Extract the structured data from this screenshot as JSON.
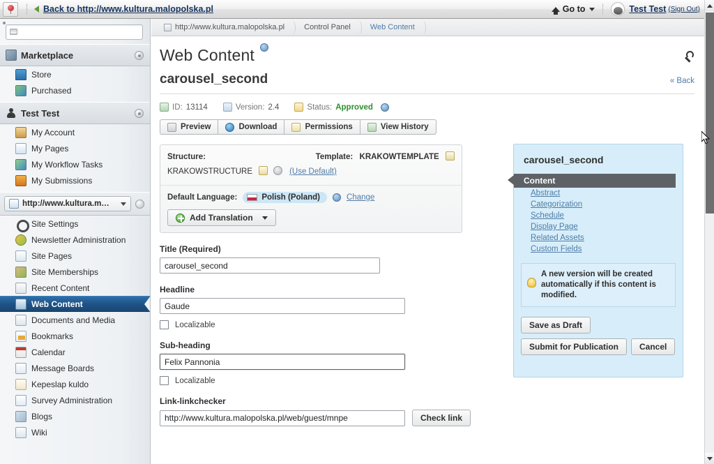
{
  "dockbar": {
    "logo_icon": "pin-marker-icon",
    "back_arrow_icon": "arrow-left-green-icon",
    "back_label": "Back to http://www.kultura.malopolska.pl",
    "home_icon": "home-icon",
    "goto_label": "Go to",
    "caret_icon": "chevron-down-icon",
    "avatar_icon": "user-avatar",
    "user_name": "Test Test",
    "sign_out": "(Sign Out)"
  },
  "sidebar": {
    "search": {
      "icon": "search-icon",
      "value": "",
      "placeholder": ""
    },
    "sections": [
      {
        "title": "Marketplace",
        "icon": "marketplace-icon",
        "gear_icon": "gear-icon",
        "items": [
          {
            "label": "Store",
            "icon": "store-icon"
          },
          {
            "label": "Purchased",
            "icon": "purchased-icon"
          }
        ]
      },
      {
        "title": "Test Test",
        "icon": "person-icon",
        "gear_icon": "gear-icon",
        "items": [
          {
            "label": "My Account",
            "icon": "my-account-icon"
          },
          {
            "label": "My Pages",
            "icon": "my-pages-icon"
          },
          {
            "label": "My Workflow Tasks",
            "icon": "workflow-tasks-icon"
          },
          {
            "label": "My Submissions",
            "icon": "submissions-icon"
          }
        ]
      }
    ],
    "site_selector": {
      "icon": "site-icon",
      "label": "http://www.kultura.mal...",
      "caret_icon": "chevron-down-icon",
      "gear_icon": "gear-icon"
    },
    "site_items": [
      {
        "label": "Site Settings",
        "icon": "gear-dark-icon",
        "selected": false
      },
      {
        "label": "Newsletter Administration",
        "icon": "newsletter-icon",
        "selected": false
      },
      {
        "label": "Site Pages",
        "icon": "site-pages-icon",
        "selected": false
      },
      {
        "label": "Site Memberships",
        "icon": "site-memberships-icon",
        "selected": false
      },
      {
        "label": "Recent Content",
        "icon": "recent-content-icon",
        "selected": false
      },
      {
        "label": "Web Content",
        "icon": "web-content-icon",
        "selected": true
      },
      {
        "label": "Documents and Media",
        "icon": "documents-media-icon",
        "selected": false
      },
      {
        "label": "Bookmarks",
        "icon": "bookmarks-icon",
        "selected": false
      },
      {
        "label": "Calendar",
        "icon": "calendar-icon",
        "selected": false
      },
      {
        "label": "Message Boards",
        "icon": "message-boards-icon",
        "selected": false
      },
      {
        "label": "Kepeslap kuldo",
        "icon": "kepeslap-icon",
        "selected": false
      },
      {
        "label": "Survey Administration",
        "icon": "survey-icon",
        "selected": false
      },
      {
        "label": "Blogs",
        "icon": "blogs-icon",
        "selected": false
      },
      {
        "label": "Wiki",
        "icon": "wiki-icon",
        "selected": false
      }
    ]
  },
  "breadcrumbs": [
    {
      "label": "http://www.kultura.malopolska.pl",
      "icon": "site-icon",
      "link": false
    },
    {
      "label": "Control Panel",
      "link": false
    },
    {
      "label": "Web Content",
      "link": true
    }
  ],
  "page": {
    "title": "Web Content",
    "help_icon": "help-icon",
    "wrench_icon": "wrench-icon",
    "content_title": "carousel_second",
    "back_label": "« Back"
  },
  "meta": {
    "id_label": "ID:",
    "id_value": "13114",
    "id_icon": "id-icon",
    "version_label": "Version:",
    "version_value": "2.4",
    "version_icon": "version-icon",
    "status_label": "Status:",
    "status_value": "Approved",
    "status_icon": "status-icon",
    "status_help_icon": "help-icon"
  },
  "toolbar": [
    {
      "label": "Preview",
      "icon": "preview-icon"
    },
    {
      "label": "Download",
      "icon": "download-icon"
    },
    {
      "label": "Permissions",
      "icon": "permissions-icon"
    },
    {
      "label": "View History",
      "icon": "history-icon"
    }
  ],
  "structure_panel": {
    "structure_label": "Structure:",
    "structure_value": "KRAKOWSTRUCTURE",
    "structure_edit_icon": "edit-icon",
    "structure_gear_icon": "gear-icon",
    "use_default": "(Use Default)",
    "template_label": "Template:",
    "template_value": "KRAKOWTEMPLATE",
    "template_edit_icon": "edit-icon",
    "language_label": "Default Language:",
    "language_value": "Polish (Poland)",
    "flag_icon": "flag-poland-icon",
    "language_help_icon": "help-icon",
    "change_label": "Change",
    "add_translation_label": "Add Translation",
    "add_translation_icon": "plus-circle-icon",
    "add_translation_caret": "chevron-down-icon"
  },
  "form": {
    "title_label": "Title (Required)",
    "title_value": "carousel_second",
    "headline_label": "Headline",
    "headline_value": "Gaude",
    "headline_localizable_label": "Localizable",
    "subheading_label": "Sub-heading",
    "subheading_value": "Felix Pannonia",
    "subheading_localizable_label": "Localizable",
    "link_label": "Link-linkchecker",
    "link_value": "http://www.kultura.malopolska.pl/web/guest/mnpe",
    "check_link_label": "Check link"
  },
  "side_panel": {
    "title": "carousel_second",
    "active_item": "Content",
    "links": [
      "Abstract",
      "Categorization",
      "Schedule",
      "Display Page",
      "Related Assets",
      "Custom Fields"
    ],
    "tip_icon": "lightbulb-icon",
    "tip_text": "A new version will be created automatically if this content is modified.",
    "save_draft_label": "Save as Draft",
    "submit_label": "Submit for Publication",
    "cancel_label": "Cancel"
  },
  "scrollbar": {
    "up_icon": "chevron-up-icon",
    "down_icon": "chevron-down-icon"
  },
  "colors": {
    "selected_nav": "#1e5185",
    "link": "#4f7ca6",
    "approved": "#2f8f2f",
    "side_panel_bg": "#d7eefa",
    "active_tab_bg": "#5e6266"
  }
}
